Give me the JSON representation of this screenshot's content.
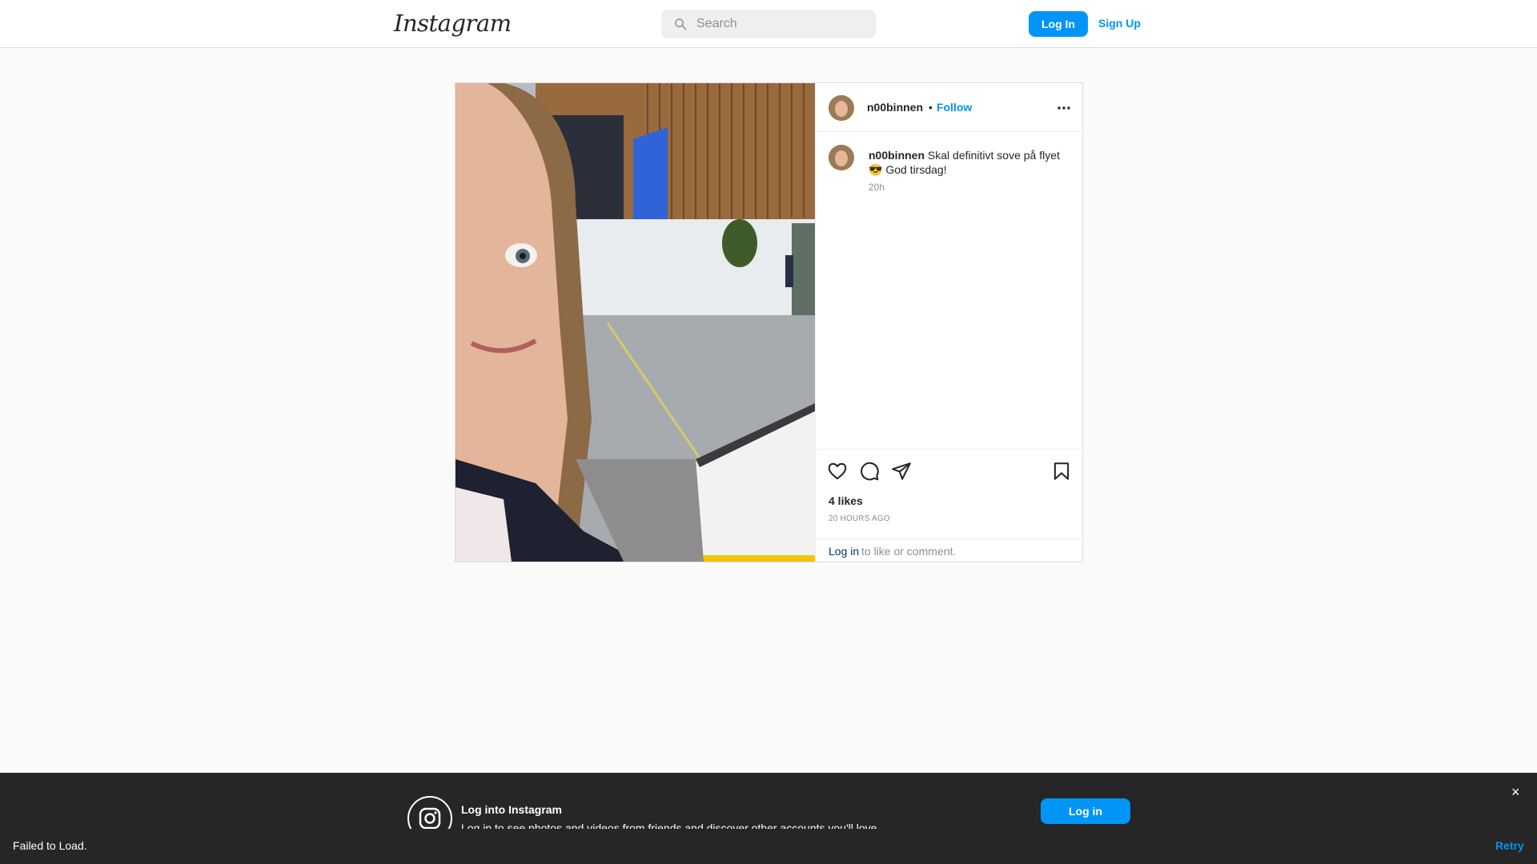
{
  "nav": {
    "logo": "Instagram",
    "search_placeholder": "Search",
    "login_label": "Log In",
    "signup_label": "Sign Up"
  },
  "post": {
    "username": "n00binnen",
    "separator": "•",
    "follow_label": "Follow",
    "caption_text": "Skal definitivt sove på flyet 😎 God tirsdag!",
    "caption_time": "20h",
    "likes": "4 likes",
    "time_ago": "20 HOURS AGO",
    "login_link": "Log in",
    "login_rest": "to like or comment."
  },
  "banner": {
    "title": "Log into Instagram",
    "subtitle": "Log in to see photos and videos from friends and discover other accounts you'll love.",
    "login_label": "Log in",
    "close_label": "×"
  },
  "toast": {
    "message": "Failed to Load.",
    "retry_label": "Retry"
  },
  "icons": [
    "search-icon",
    "more-icon",
    "heart-icon",
    "comment-icon",
    "share-icon",
    "bookmark-icon",
    "instagram-icon",
    "close-icon"
  ],
  "colors": {
    "accent": "#0095f6",
    "link_dark": "#00376b",
    "banner_bg": "#262626"
  }
}
